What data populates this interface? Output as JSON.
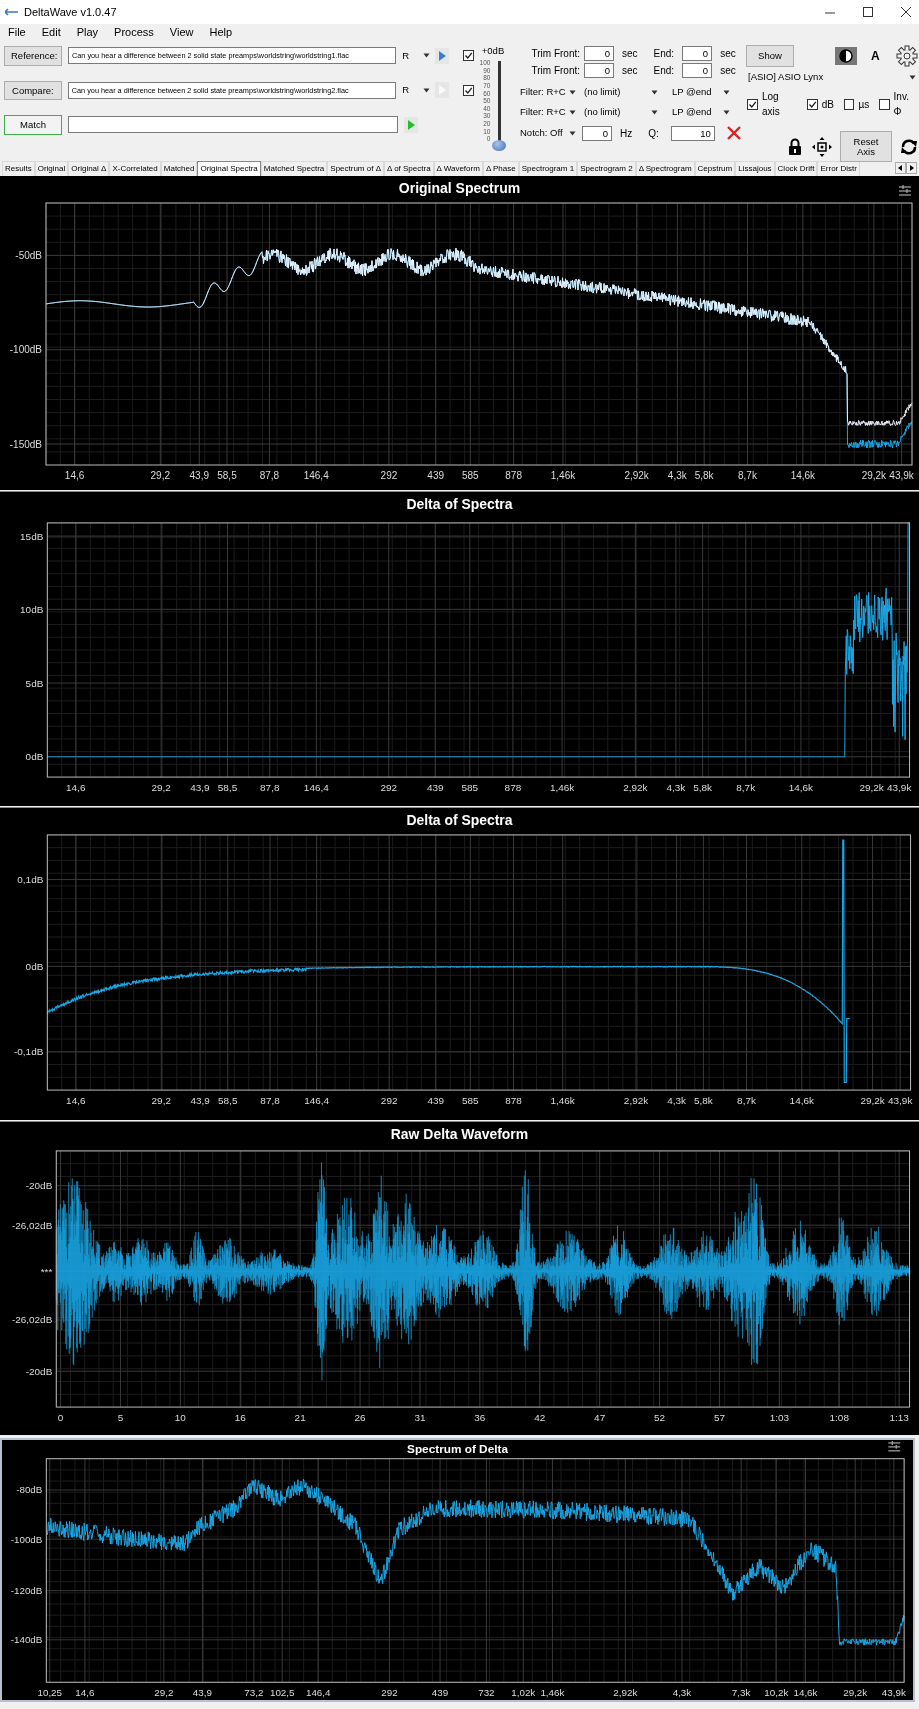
{
  "window": {
    "title": "DeltaWave v1.0.47"
  },
  "menu": [
    "File",
    "Edit",
    "Play",
    "Process",
    "View",
    "Help"
  ],
  "inputs": [
    {
      "button": "Reference:",
      "path": "Can you hear a difference between 2 solid state preamps\\worldstring\\worldstring1.flac",
      "channel": "R",
      "play_enabled": true,
      "checked": true
    },
    {
      "button": "Compare:",
      "path": "Can you hear a difference between 2 solid state preamps\\worldstring\\worldstring2.flac",
      "channel": "R",
      "play_enabled": false,
      "checked": true
    }
  ],
  "match": {
    "button": "Match"
  },
  "volume": {
    "label": "+0dB",
    "scale": [
      "100",
      "90",
      "80",
      "70",
      "60",
      "50",
      "40",
      "30",
      "20",
      "10",
      "0"
    ],
    "level": 0
  },
  "trim": [
    {
      "label": "Trim Front:",
      "front": "0",
      "unit": "sec",
      "end_label": "End:",
      "end": "0",
      "end_unit": "sec"
    },
    {
      "label": "Trim Front:",
      "front": "0",
      "unit": "sec",
      "end_label": "End:",
      "end": "0",
      "end_unit": "sec"
    }
  ],
  "filters": [
    {
      "type": "Filter: R+C",
      "limit": "(no limit)",
      "lowpass": "LP @end"
    },
    {
      "type": "Filter: R+C",
      "limit": "(no limit)",
      "lowpass": "LP @end"
    }
  ],
  "notch": {
    "mode": "Notch: Off",
    "freq": "0",
    "unit": "Hz",
    "q_label": "Q:",
    "q": "10"
  },
  "display": {
    "show_button": "Show",
    "font_button": "A",
    "device": "[ASIO] ASIO Lynx",
    "reset_button": "Reset Axis"
  },
  "options": [
    {
      "label": "Log axis",
      "checked": true
    },
    {
      "label": "dB",
      "checked": true
    },
    {
      "label": "µs",
      "checked": false
    },
    {
      "label": "Inv. Φ",
      "checked": false
    }
  ],
  "tabs": [
    {
      "label": "Results",
      "selected": false
    },
    {
      "label": "Original",
      "selected": false
    },
    {
      "label": "Original Δ",
      "selected": false
    },
    {
      "label": "X-Correlated",
      "selected": false
    },
    {
      "label": "Matched",
      "selected": false
    },
    {
      "label": "Original Spectra",
      "selected": true
    },
    {
      "label": "Matched Spectra",
      "selected": false
    },
    {
      "label": "Spectrum of Δ",
      "selected": false
    },
    {
      "label": "Δ of Spectra",
      "selected": false
    },
    {
      "label": "Δ Waveform",
      "selected": false
    },
    {
      "label": "Δ Phase",
      "selected": false
    },
    {
      "label": "Spectrogram 1",
      "selected": false
    },
    {
      "label": "Spectrogram 2",
      "selected": false
    },
    {
      "label": "Δ Spectrogram",
      "selected": false
    },
    {
      "label": "Cepstrum",
      "selected": false
    },
    {
      "label": "Lissajous",
      "selected": false
    },
    {
      "label": "Clock Drift",
      "selected": false
    },
    {
      "label": "Error Distr",
      "selected": false
    }
  ],
  "charts": [
    {
      "kind": "dual-spectrum",
      "title": "Original Spectrum",
      "settings": true,
      "yticks": [
        "-50dB",
        "-100dB",
        "-150dB"
      ],
      "xticks": [
        "14,6",
        "29,2",
        "43,9",
        "58,5",
        "87,8",
        "146,4",
        "292",
        "439",
        "585",
        "878",
        "1,46k",
        "2,92k",
        "4,3k",
        "5,8k",
        "8,7k",
        "14,6k",
        "29,2k",
        "43,9k"
      ]
    },
    {
      "kind": "delta-step",
      "title": "Delta of Spectra",
      "settings": false,
      "yticks": [
        "15dB",
        "10dB",
        "5dB",
        "0dB"
      ],
      "xticks": [
        "14,6",
        "29,2",
        "43,9",
        "58,5",
        "87,8",
        "146,4",
        "292",
        "439",
        "585",
        "878",
        "1,46k",
        "2,92k",
        "4,3k",
        "5,8k",
        "8,7k",
        "14,6k",
        "29,2k",
        "43,9k"
      ]
    },
    {
      "kind": "delta-fine",
      "title": "Delta of Spectra",
      "settings": false,
      "yticks": [
        "0,1dB",
        "0dB",
        "-0,1dB"
      ],
      "xticks": [
        "14,6",
        "29,2",
        "43,9",
        "58,5",
        "87,8",
        "146,4",
        "292",
        "439",
        "585",
        "878",
        "1,46k",
        "2,92k",
        "4,3k",
        "5,8k",
        "8,7k",
        "14,6k",
        "29,2k",
        "43,9k"
      ]
    },
    {
      "kind": "waveform",
      "title": "Raw Delta Waveform",
      "settings": false,
      "yticks": [
        "-20dB",
        "-26,02dB",
        "***",
        "-26,02dB",
        "-20dB"
      ],
      "xticks": [
        "0",
        "5",
        "10",
        "16",
        "21",
        "26",
        "31",
        "36",
        "42",
        "47",
        "52",
        "57",
        "1:03",
        "1:08",
        "1:13"
      ]
    },
    {
      "kind": "delta-spectrum",
      "title": "Spectrum of Delta",
      "settings": true,
      "yticks": [
        "-80dB",
        "-100dB",
        "-120dB",
        "-140dB"
      ],
      "xticks": [
        "10,25",
        "14,6",
        "29,2",
        "43,9",
        "73,2",
        "102,5",
        "146,4",
        "292",
        "439",
        "732",
        "1,02k",
        "1,46k",
        "2,92k",
        "4,3k",
        "7,3k",
        "10,2k",
        "14,6k",
        "29,2k",
        "43,9k"
      ]
    }
  ]
}
